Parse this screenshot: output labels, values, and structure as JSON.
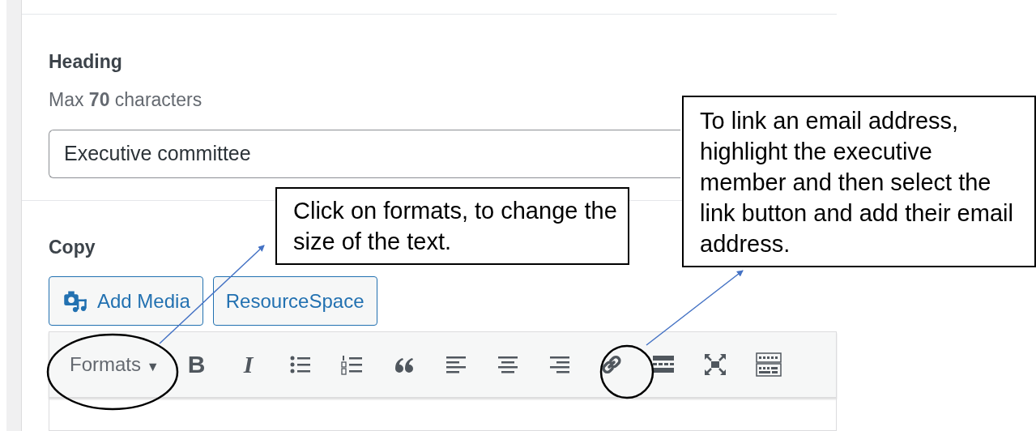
{
  "heading_field": {
    "label": "Heading",
    "hint": "Max **70** characters",
    "value": "Executive committee"
  },
  "copy_field": {
    "label": "Copy",
    "media_buttons": [
      {
        "label": "Add Media",
        "kind": "media"
      },
      {
        "label": "ResourceSpace",
        "kind": "plain"
      }
    ],
    "toolbar": {
      "formats": {
        "label": "Formats",
        "caret": "▼"
      },
      "tools": [
        {
          "kind": "bold",
          "glyph": "B"
        },
        {
          "kind": "italic",
          "glyph": "I"
        },
        {
          "kind": "bullet-list"
        },
        {
          "kind": "numbered-list"
        },
        {
          "kind": "quote"
        },
        {
          "kind": "align-left"
        },
        {
          "kind": "align-center"
        },
        {
          "kind": "align-right"
        },
        {
          "kind": "link"
        },
        {
          "kind": "read-more"
        },
        {
          "kind": "fullscreen"
        },
        {
          "kind": "toolbar-toggle"
        }
      ]
    }
  },
  "callouts": [
    {
      "text": "Click on formats, to change the size of the text."
    },
    {
      "text": "To link an email address, highlight the executive member and then select the link button and add their email address."
    }
  ]
}
